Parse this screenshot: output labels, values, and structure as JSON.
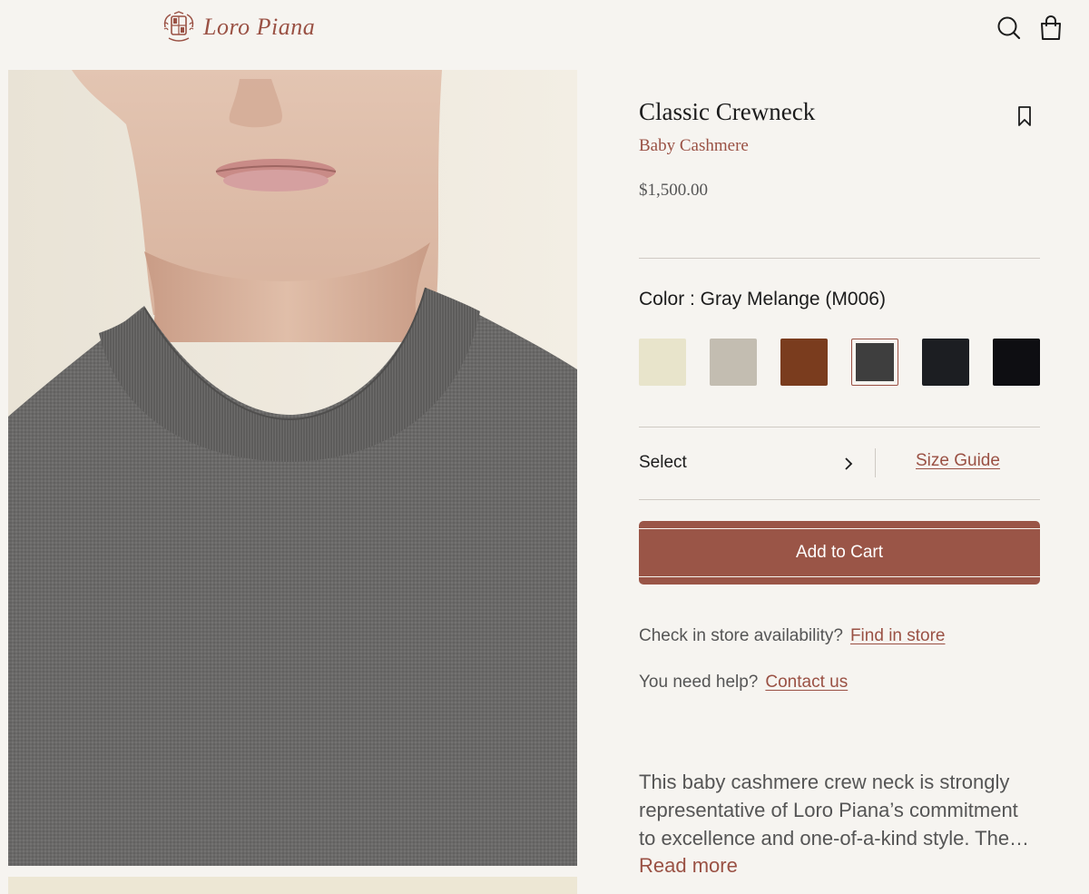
{
  "brand": {
    "logo_text": "Loro Piana",
    "color": "#9a5144"
  },
  "header": {
    "icons": [
      "search-icon",
      "shopping-bag-icon"
    ]
  },
  "product": {
    "title": "Classic Crewneck",
    "subtitle": "Baby Cashmere",
    "price": "$1,500.00",
    "color_label": "Color : Gray Melange (M006)",
    "swatches": [
      {
        "color": "#e8e4cb",
        "selected": false
      },
      {
        "color": "#c3bdb1",
        "selected": false
      },
      {
        "color": "#7a3c1e",
        "selected": false
      },
      {
        "color": "#3e3e3e",
        "selected": true
      },
      {
        "color": "#1c1e22",
        "selected": false
      },
      {
        "color": "#0e0e12",
        "selected": false
      }
    ],
    "size_select_label": "Select",
    "size_guide_label": "Size Guide",
    "add_to_cart_label": "Add to Cart",
    "store_check_text": "Check in store availability?",
    "find_in_store_label": "Find in store",
    "help_text": "You need help?",
    "contact_label": "Contact us",
    "description": "This baby cashmere crew neck is strongly representative of Loro Piana’s commitment to excellence and one-of-a-kind style. The…",
    "read_more_label": "Read more"
  },
  "colors": {
    "accent": "#9a5144",
    "button": "#9a5547",
    "background": "#f6f4f0"
  }
}
